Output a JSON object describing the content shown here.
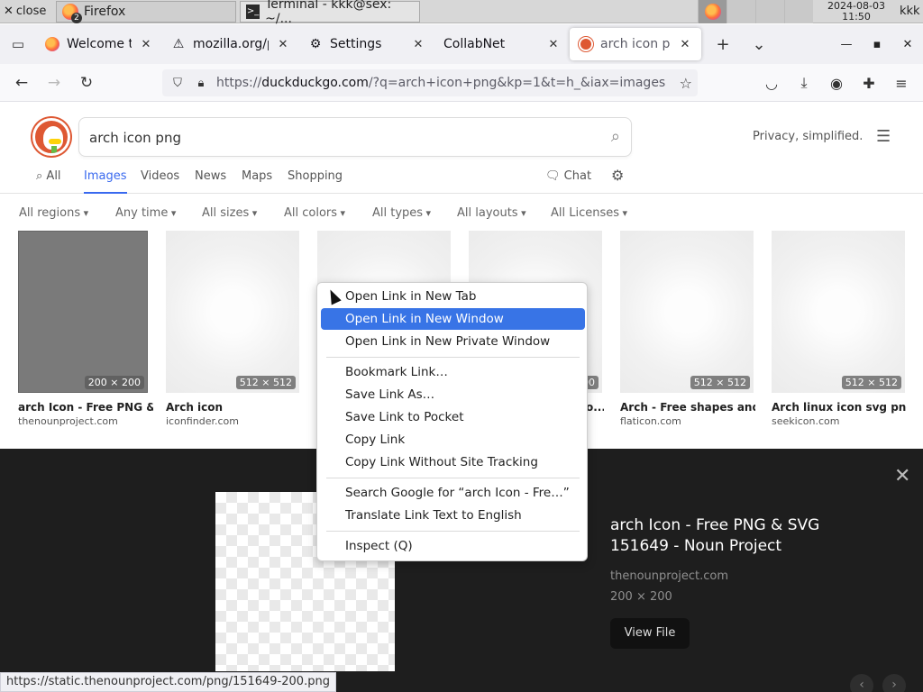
{
  "taskbar": {
    "close_label": "close",
    "tasks": [
      {
        "label": "Firefox",
        "badge": "2"
      },
      {
        "label": "Terminal - kkk@sex: ~/..."
      }
    ],
    "clock_date": "2024-08-03",
    "clock_time": "11:50",
    "user": "kkk"
  },
  "tabs": [
    {
      "title": "Welcome to Fi",
      "icon": "firefox-icon"
    },
    {
      "title": "mozilla.org/pr",
      "icon": "warning-icon"
    },
    {
      "title": "Settings",
      "icon": "gear-icon"
    },
    {
      "title": "CollabNet",
      "icon": "none"
    },
    {
      "title": "arch icon png",
      "icon": "duckduckgo-icon",
      "active": true
    }
  ],
  "url": {
    "prefix": "https://",
    "host": "duckduckgo.com",
    "rest": "/?q=arch+icon+png&kp=1&t=h_&iax=images&ia=images"
  },
  "ddg": {
    "query": "arch icon png",
    "tagline": "Privacy, simplified.",
    "nav": [
      "All",
      "Images",
      "Videos",
      "News",
      "Maps",
      "Shopping"
    ],
    "active_nav": "Images",
    "chat_label": "Chat",
    "filters": [
      "All regions",
      "Any time",
      "All sizes",
      "All colors",
      "All types",
      "All layouts",
      "All Licenses"
    ]
  },
  "results": [
    {
      "title": "arch Icon - Free PNG &...",
      "source": "thenounproject.com",
      "dim": "200 × 200"
    },
    {
      "title": "Arch icon",
      "source": "iconfinder.com",
      "dim": "512 × 512"
    },
    {
      "title": "",
      "source": "",
      "dim": ""
    },
    {
      "title": "o...",
      "source": "",
      "dim": "00"
    },
    {
      "title": "Arch - Free shapes and...",
      "source": "flaticon.com",
      "dim": "512 × 512"
    },
    {
      "title": "Arch linux icon svg png...",
      "source": "seekicon.com",
      "dim": "512 × 512"
    }
  ],
  "detail": {
    "title": "arch Icon - Free PNG & SVG 151649 - Noun Project",
    "source": "thenounproject.com",
    "size": "200 × 200",
    "button": "View File"
  },
  "status_url": "https://static.thenounproject.com/png/151649-200.png",
  "context_menu": {
    "items": [
      "Open Link in New Tab",
      "Open Link in New Window",
      "Open Link in New Private Window",
      "Bookmark Link…",
      "Save Link As…",
      "Save Link to Pocket",
      "Copy Link",
      "Copy Link Without Site Tracking",
      "Search Google for “arch Icon - Fre…”",
      "Translate Link Text to English",
      "Inspect (Q)"
    ],
    "highlighted": "Open Link in New Window"
  },
  "colors": {
    "accent": "#3969ef",
    "menu_highlight": "#3874e6",
    "ddg_orange": "#de5833",
    "detail_bg": "#1e1e1e"
  }
}
